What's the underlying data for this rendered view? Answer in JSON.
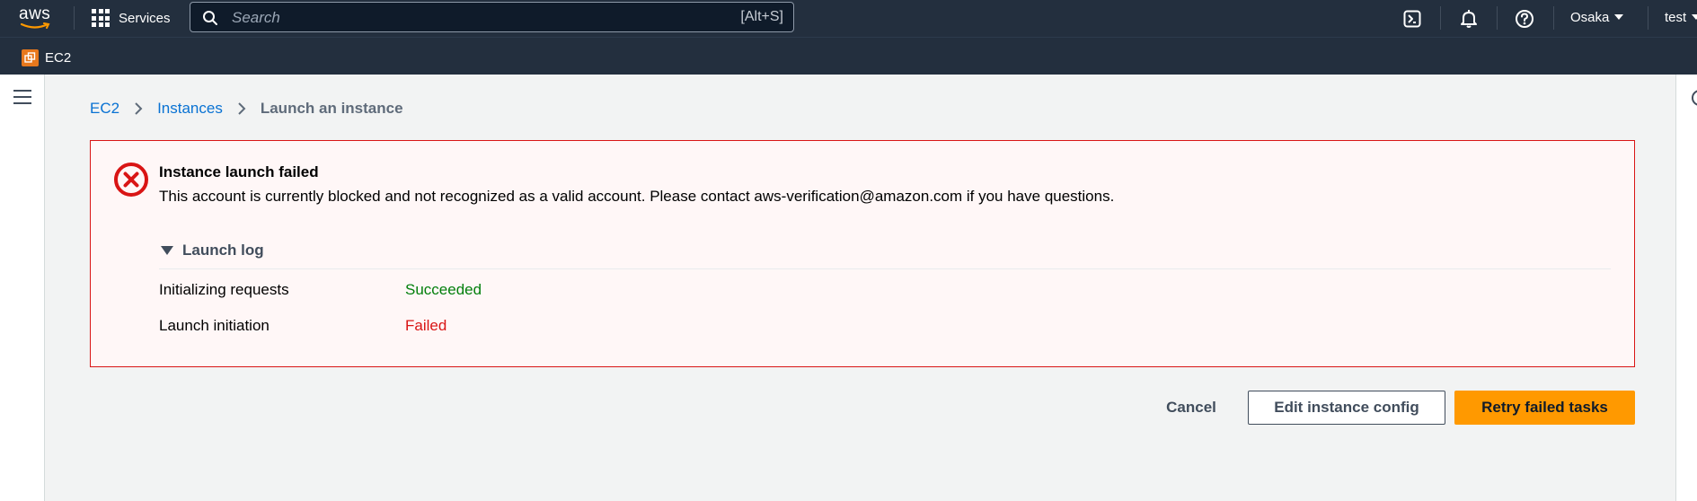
{
  "topbar": {
    "logo_text": "aws",
    "services_label": "Services",
    "search_placeholder": "Search",
    "search_shortcut": "[Alt+S]",
    "region": "Osaka",
    "user": "test"
  },
  "subbar": {
    "service_label": "EC2"
  },
  "breadcrumb": {
    "items": [
      "EC2",
      "Instances"
    ],
    "current": "Launch an instance"
  },
  "alert": {
    "title": "Instance launch failed",
    "message": "This account is currently blocked and not recognized as a valid account. Please contact aws-verification@amazon.com if you have questions.",
    "log_title": "Launch log",
    "log": [
      {
        "task": "Initializing requests",
        "status": "Succeeded"
      },
      {
        "task": "Launch initiation",
        "status": "Failed"
      }
    ]
  },
  "actions": {
    "cancel": "Cancel",
    "edit": "Edit instance config",
    "retry": "Retry failed tasks"
  },
  "colors": {
    "nav_bg": "#232f3e",
    "link": "#0972d3",
    "error": "#d91515",
    "success": "#037f0c",
    "primary": "#ff9900"
  }
}
